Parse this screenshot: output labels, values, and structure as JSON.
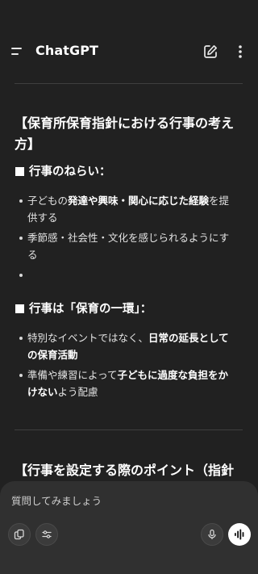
{
  "header": {
    "title": "ChatGPT",
    "menu_icon": "menu-icon",
    "edit_icon": "new-chat-icon",
    "more_icon": "more-vertical-icon"
  },
  "message": {
    "section1_title_line1": "【保育所保育指針における行事の考え",
    "section1_title_line2": "方】",
    "aim_heading": "行事のねらい：",
    "aim_bullets": [
      {
        "pre": "子どもの",
        "bold": "発達や興味・関心に応じた経験",
        "post": "を提",
        "line2": "供する"
      },
      {
        "line1": "季節感・社会性・文化を感じられるようにす",
        "line2": "る"
      },
      {
        "line1": ""
      }
    ],
    "part_heading": "行事は「保育の一環」：",
    "part_bullets": [
      {
        "pre": "特別なイベントではなく、",
        "bold": "日常の延長として",
        "line2_bold": "の保育活動"
      },
      {
        "pre": "準備や練習によって",
        "bold": "子どもに過度な負担をか",
        "line2_bold": "けない",
        "line2_post": "よう配慮"
      }
    ],
    "section2_title": "【行事を設定する際のポイント（指針"
  },
  "composer": {
    "placeholder": "質問してみましょう",
    "attach_icon": "attach-icon",
    "tools_icon": "tools-sliders-icon",
    "mic_icon": "microphone-icon",
    "voice_icon": "voice-mode-icon"
  },
  "colors": {
    "background": "#212121",
    "composer_bg": "#303030",
    "text": "#ececec"
  }
}
